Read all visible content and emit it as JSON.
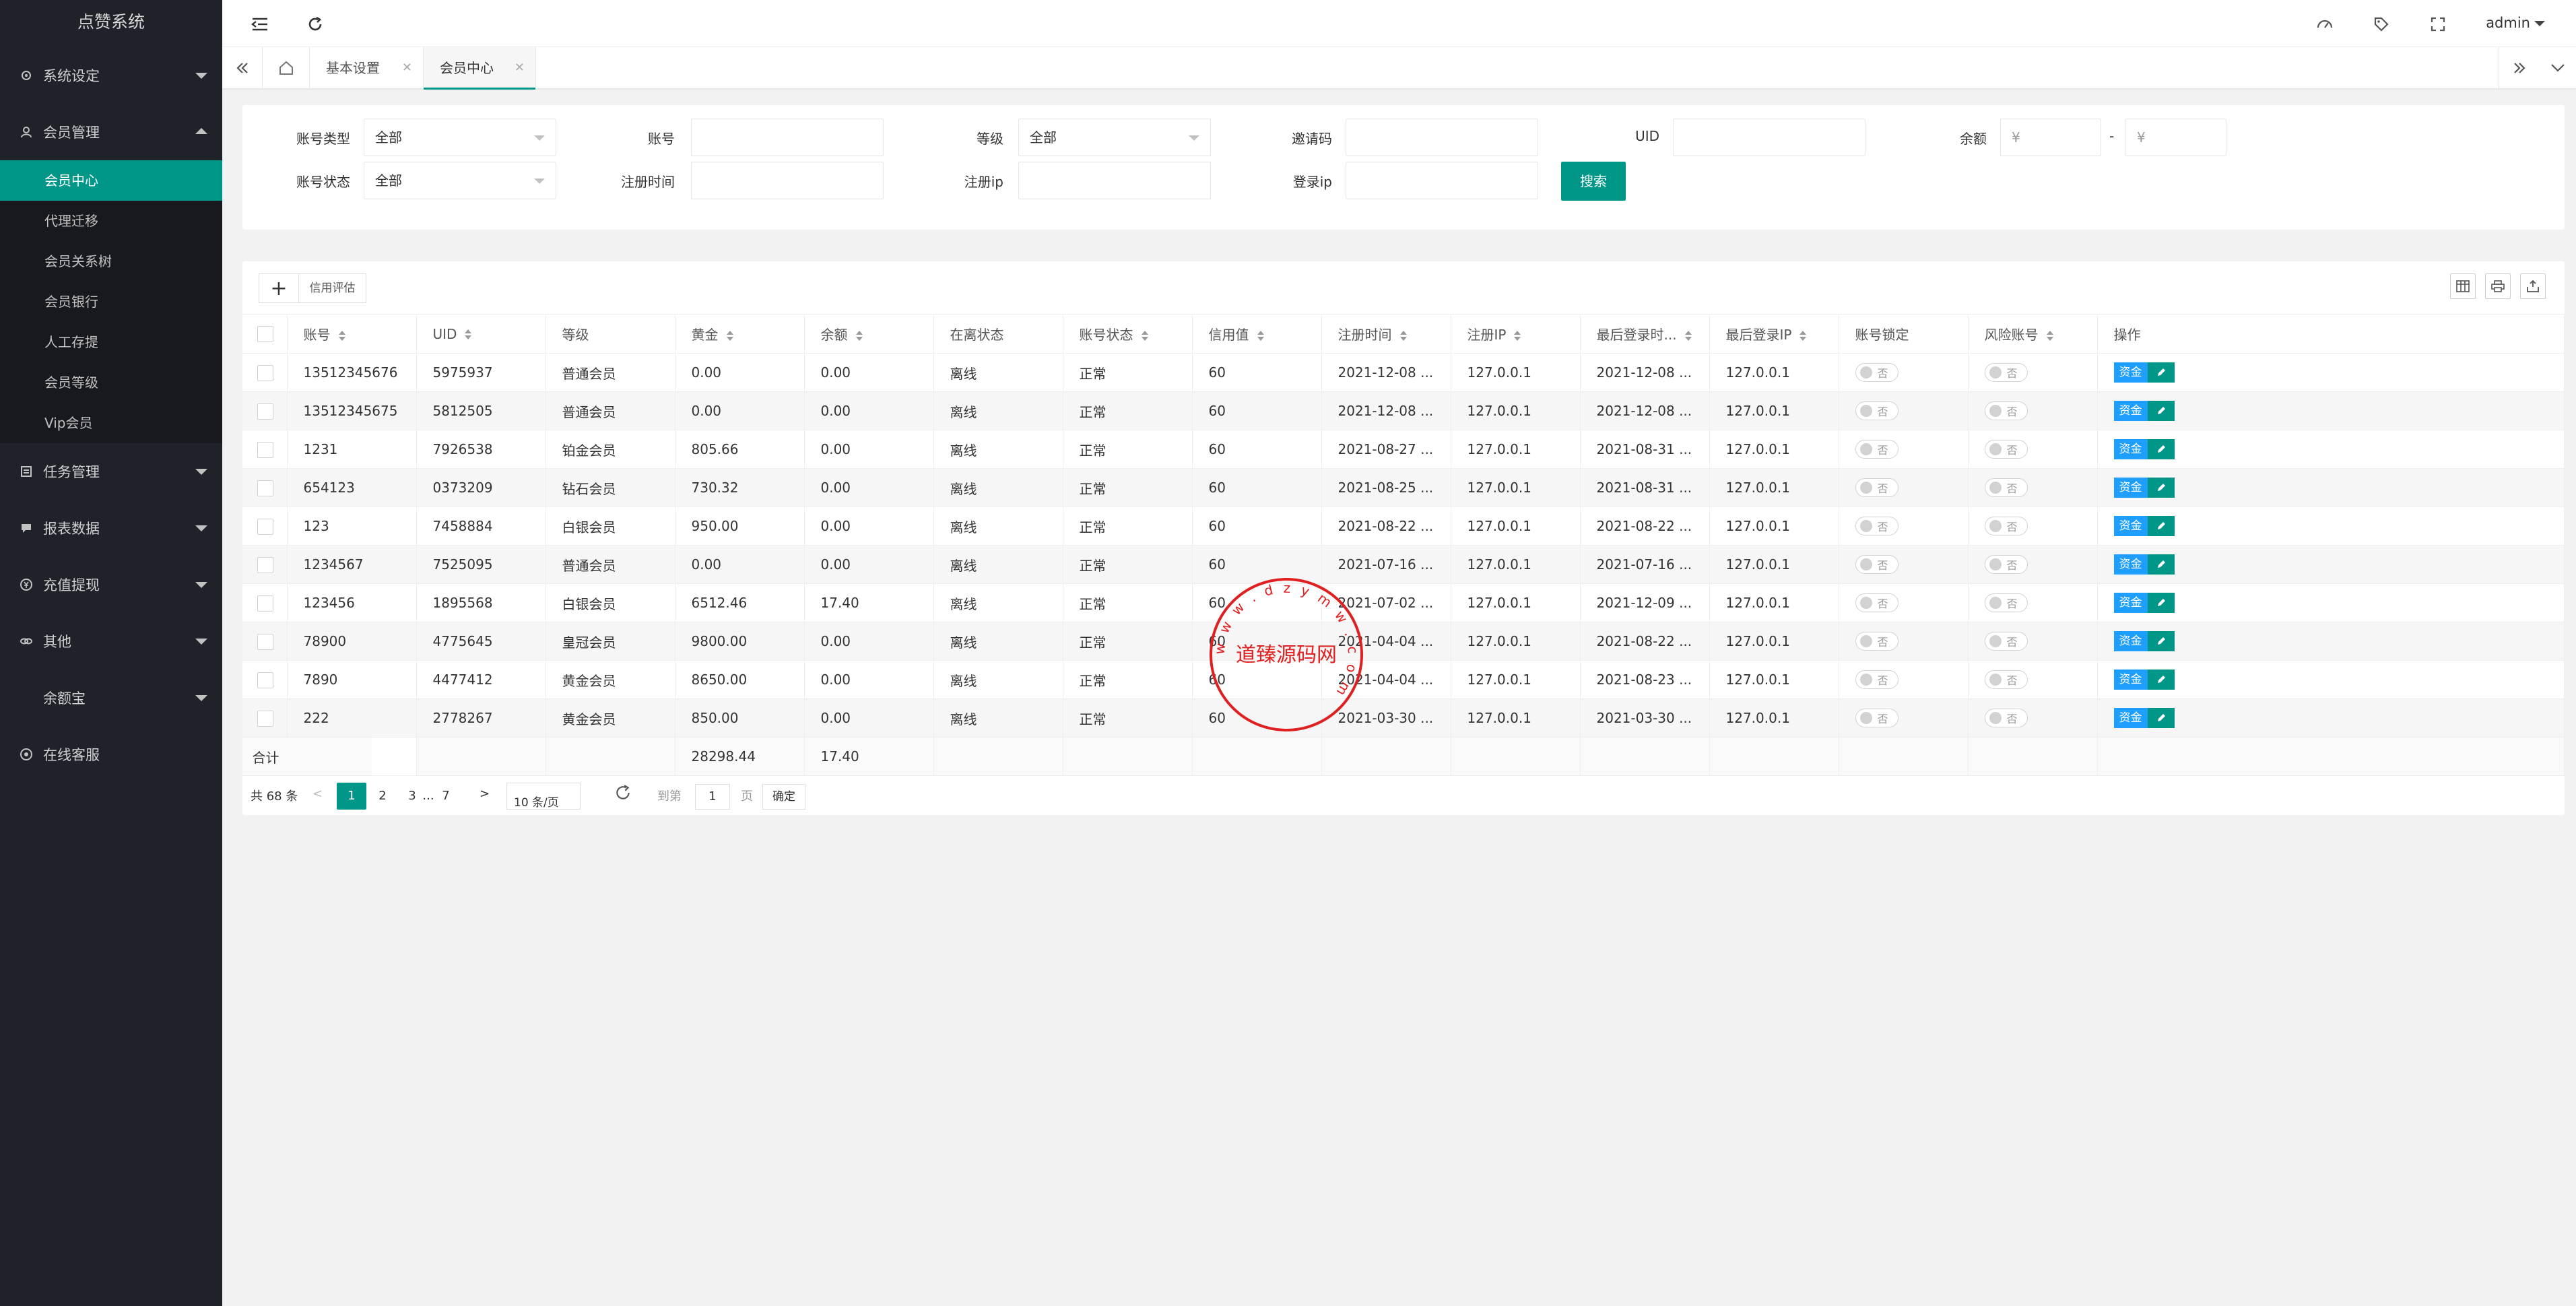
{
  "app": {
    "title": "点赞系统"
  },
  "sidebar": {
    "groups": [
      {
        "label": "系统设定"
      },
      {
        "label": "会员管理",
        "items": [
          "会员中心",
          "代理迁移",
          "会员关系树",
          "会员银行",
          "人工存提",
          "会员等级",
          "Vip会员"
        ]
      },
      {
        "label": "任务管理"
      },
      {
        "label": "报表数据"
      },
      {
        "label": "充值提现"
      },
      {
        "label": "其他"
      },
      {
        "label": "余额宝"
      },
      {
        "label": "在线客服"
      }
    ]
  },
  "header": {
    "user": "admin"
  },
  "tabs": [
    {
      "label": "基本设置"
    },
    {
      "label": "会员中心"
    }
  ],
  "search": {
    "account_type_label": "账号类型",
    "account_type_value": "全部",
    "account_label": "账号",
    "level_label": "等级",
    "level_value": "全部",
    "invite_label": "邀请码",
    "uid_label": "UID",
    "balance_label": "余额",
    "yen": "¥",
    "dash": "-",
    "status_label": "账号状态",
    "status_value": "全部",
    "reg_time_label": "注册时间",
    "reg_ip_label": "注册ip",
    "login_ip_label": "登录ip",
    "search_button": "搜索"
  },
  "toolbar": {
    "add": "+",
    "credit": "信用评估"
  },
  "table": {
    "columns": [
      "账号",
      "UID",
      "等级",
      "黄金",
      "余额",
      "在离状态",
      "账号状态",
      "信用值",
      "注册时间",
      "注册IP",
      "最后登录时...",
      "最后登录IP",
      "账号锁定",
      "风险账号",
      "操作"
    ],
    "rows": [
      [
        "13512345676",
        "5975937",
        "普通会员",
        "0.00",
        "0.00",
        "离线",
        "正常",
        "60",
        "2021-12-08 ...",
        "127.0.0.1",
        "2021-12-08 ...",
        "127.0.0.1"
      ],
      [
        "13512345675",
        "5812505",
        "普通会员",
        "0.00",
        "0.00",
        "离线",
        "正常",
        "60",
        "2021-12-08 ...",
        "127.0.0.1",
        "2021-12-08 ...",
        "127.0.0.1"
      ],
      [
        "1231",
        "7926538",
        "铂金会员",
        "805.66",
        "0.00",
        "离线",
        "正常",
        "60",
        "2021-08-27 ...",
        "127.0.0.1",
        "2021-08-31 ...",
        "127.0.0.1"
      ],
      [
        "654123",
        "0373209",
        "钻石会员",
        "730.32",
        "0.00",
        "离线",
        "正常",
        "60",
        "2021-08-25 ...",
        "127.0.0.1",
        "2021-08-31 ...",
        "127.0.0.1"
      ],
      [
        "123",
        "7458884",
        "白银会员",
        "950.00",
        "0.00",
        "离线",
        "正常",
        "60",
        "2021-08-22 ...",
        "127.0.0.1",
        "2021-08-22 ...",
        "127.0.0.1"
      ],
      [
        "1234567",
        "7525095",
        "普通会员",
        "0.00",
        "0.00",
        "离线",
        "正常",
        "60",
        "2021-07-16 ...",
        "127.0.0.1",
        "2021-07-16 ...",
        "127.0.0.1"
      ],
      [
        "123456",
        "1895568",
        "白银会员",
        "6512.46",
        "17.40",
        "离线",
        "正常",
        "60",
        "2021-07-02 ...",
        "127.0.0.1",
        "2021-12-09 ...",
        "127.0.0.1"
      ],
      [
        "78900",
        "4775645",
        "皇冠会员",
        "9800.00",
        "0.00",
        "离线",
        "正常",
        "60",
        "2021-04-04 ...",
        "127.0.0.1",
        "2021-08-22 ...",
        "127.0.0.1"
      ],
      [
        "7890",
        "4477412",
        "黄金会员",
        "8650.00",
        "0.00",
        "离线",
        "正常",
        "60",
        "2021-04-04 ...",
        "127.0.0.1",
        "2021-08-23 ...",
        "127.0.0.1"
      ],
      [
        "222",
        "2778267",
        "黄金会员",
        "850.00",
        "0.00",
        "离线",
        "正常",
        "60",
        "2021-03-30 ...",
        "127.0.0.1",
        "2021-03-30 ...",
        "127.0.0.1"
      ]
    ],
    "switch_label": "否",
    "fund_button": "资金",
    "total_label": "合计",
    "total_gold": "28298.44",
    "total_balance": "17.40"
  },
  "pager": {
    "total": "共 68 条",
    "pages": [
      "1",
      "2",
      "3",
      "...",
      "7"
    ],
    "page_size": "10 条/页",
    "goto_label": "到第",
    "goto_value": "1",
    "page_unit": "页",
    "confirm": "确定"
  },
  "watermark": {
    "text": "道臻源码网",
    "ring": "w w w . d z y m w . c o m"
  },
  "colors": {
    "accent": "#009688",
    "sidebar": "#20222a",
    "blue": "#1e9fff",
    "stamp": "#e02020"
  }
}
